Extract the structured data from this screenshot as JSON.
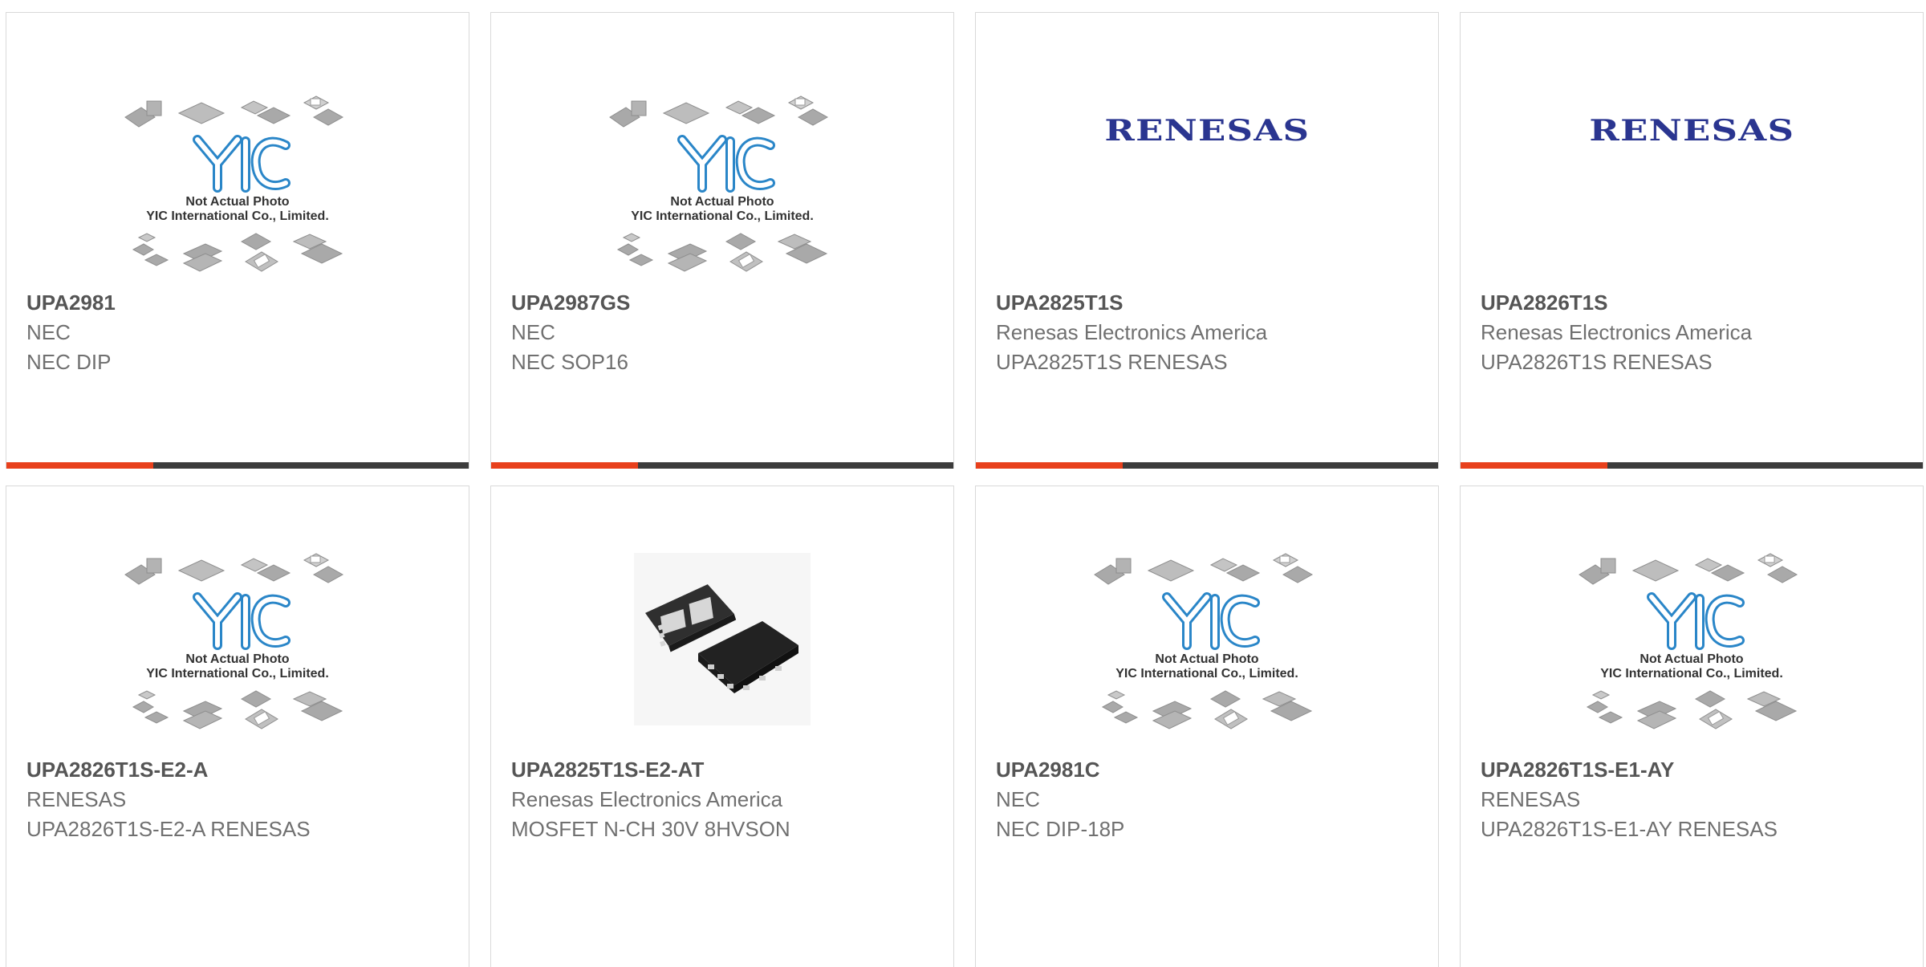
{
  "colors": {
    "accent": "#e8401c",
    "bar_dark": "#3c3c3c",
    "renesas_blue": "#2a3590",
    "yic_blue": "#2a86c8"
  },
  "placeholder": {
    "yic_title": "Not Actual Photo",
    "yic_sub": "YIC International Co., Limited."
  },
  "renesas_logo_text": "RENESAS",
  "products": [
    {
      "part": "UPA2981",
      "manufacturer": "NEC",
      "description": "NEC DIP",
      "image": "yic-placeholder"
    },
    {
      "part": "UPA2987GS",
      "manufacturer": "NEC",
      "description": "NEC SOP16",
      "image": "yic-placeholder"
    },
    {
      "part": "UPA2825T1S",
      "manufacturer": "Renesas Electronics America",
      "description": "UPA2825T1S RENESAS",
      "image": "renesas-logo"
    },
    {
      "part": "UPA2826T1S",
      "manufacturer": "Renesas Electronics America",
      "description": "UPA2826T1S RENESAS",
      "image": "renesas-logo"
    },
    {
      "part": "UPA2826T1S-E2-A",
      "manufacturer": "RENESAS",
      "description": "UPA2826T1S-E2-A RENESAS",
      "image": "yic-placeholder"
    },
    {
      "part": "UPA2825T1S-E2-AT",
      "manufacturer": "Renesas Electronics America",
      "description": "MOSFET N-CH 30V 8HVSON",
      "image": "mosfet-package"
    },
    {
      "part": "UPA2981C",
      "manufacturer": "NEC",
      "description": "NEC DIP-18P",
      "image": "yic-placeholder"
    },
    {
      "part": "UPA2826T1S-E1-AY",
      "manufacturer": "RENESAS",
      "description": "UPA2826T1S-E1-AY RENESAS",
      "image": "yic-placeholder"
    }
  ]
}
